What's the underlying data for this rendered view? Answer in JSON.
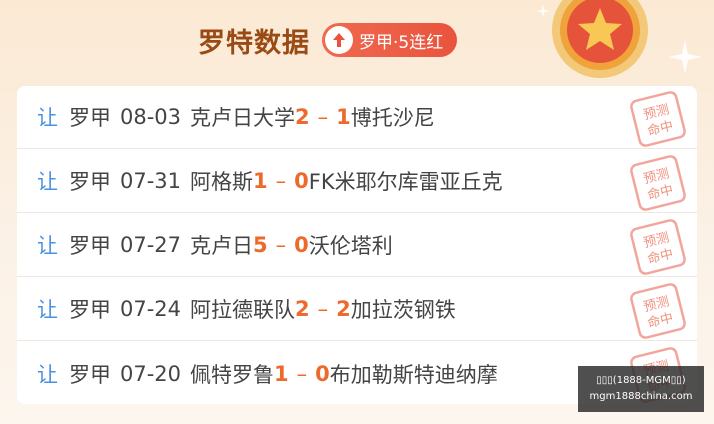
{
  "header": {
    "title": "罗特数据",
    "streak": "罗甲·5连红"
  },
  "matches": [
    {
      "tag": "让",
      "league": "罗甲",
      "date": "08-03",
      "home": "克卢日大学",
      "home_score": "2",
      "sep": "–",
      "away_score": "1",
      "away": "博托沙尼"
    },
    {
      "tag": "让",
      "league": "罗甲",
      "date": "07-31",
      "home": "阿格斯",
      "home_score": "1",
      "sep": "–",
      "away_score": "0",
      "away": "FK米耶尔库雷亚丘克"
    },
    {
      "tag": "让",
      "league": "罗甲",
      "date": "07-27",
      "home": "克卢日",
      "home_score": "5",
      "sep": "–",
      "away_score": "0",
      "away": "沃伦塔利"
    },
    {
      "tag": "让",
      "league": "罗甲",
      "date": "07-24",
      "home": "阿拉德联队",
      "home_score": "2",
      "sep": "–",
      "away_score": "2",
      "away": "加拉茨钢铁"
    },
    {
      "tag": "让",
      "league": "罗甲",
      "date": "07-20",
      "home": "佩特罗鲁",
      "home_score": "1",
      "sep": "–",
      "away_score": "0",
      "away": "布加勒斯特迪纳摩"
    }
  ],
  "stamp": {
    "line1": "预测",
    "line2": "命中"
  },
  "watermark": {
    "line1": "▯▯▯(1888-MGM▯▯)",
    "line2": "mgm1888china.com"
  },
  "colors": {
    "accent": "#ee6a2c",
    "tag": "#4b8fe0",
    "title": "#9a4a14",
    "badge": "#e9533e"
  }
}
